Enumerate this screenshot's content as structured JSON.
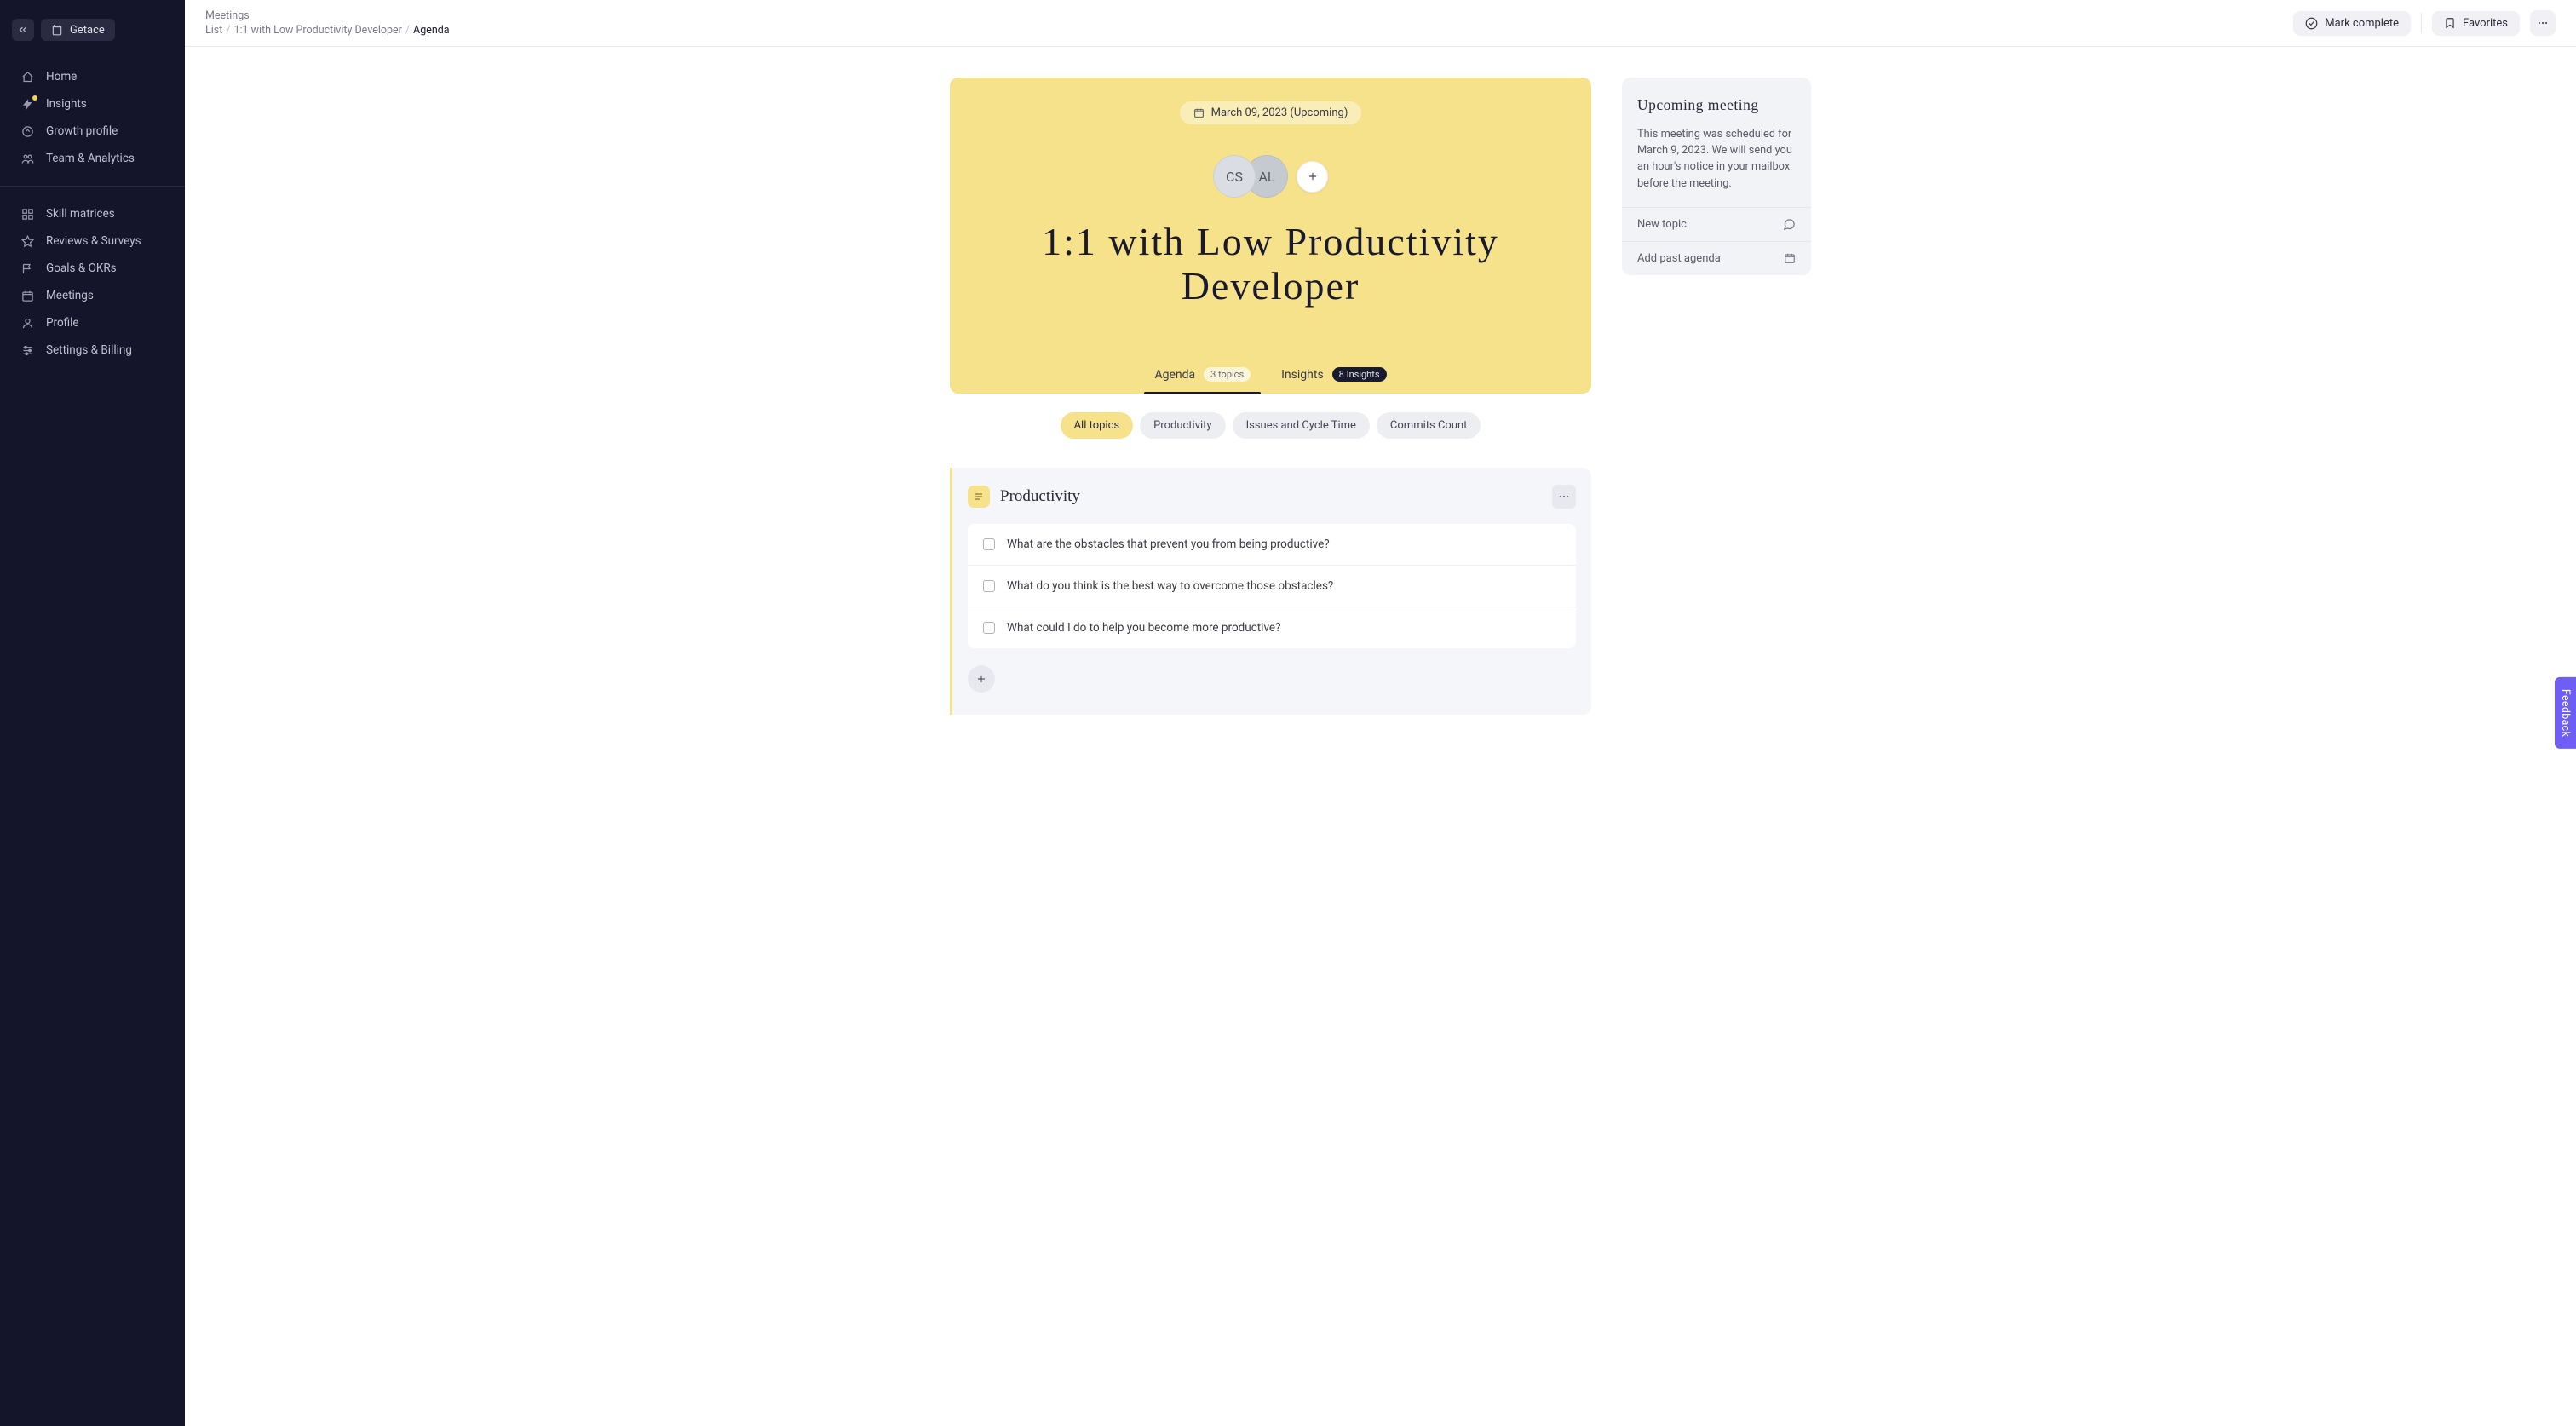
{
  "brand": "Getace",
  "breadcrumb": {
    "top": "Meetings",
    "list": "List",
    "meeting": "1:1 with Low Productivity Developer",
    "current": "Agenda"
  },
  "topbar": {
    "mark_complete": "Mark complete",
    "favorites": "Favorites"
  },
  "sidebar": {
    "section1": [
      {
        "id": "home",
        "label": "Home",
        "icon": "home"
      },
      {
        "id": "insights",
        "label": "Insights",
        "icon": "bolt",
        "badge": true
      },
      {
        "id": "growth",
        "label": "Growth profile",
        "icon": "growth"
      },
      {
        "id": "team",
        "label": "Team & Analytics",
        "icon": "team"
      }
    ],
    "section2": [
      {
        "id": "skill",
        "label": "Skill matrices",
        "icon": "grid"
      },
      {
        "id": "reviews",
        "label": "Reviews & Surveys",
        "icon": "star"
      },
      {
        "id": "goals",
        "label": "Goals & OKRs",
        "icon": "flag"
      },
      {
        "id": "meetings",
        "label": "Meetings",
        "icon": "calendar"
      },
      {
        "id": "profile",
        "label": "Profile",
        "icon": "user"
      },
      {
        "id": "settings",
        "label": "Settings & Billing",
        "icon": "sliders"
      }
    ]
  },
  "hero": {
    "date": "March 09, 2023 (Upcoming)",
    "title": "1:1 with Low Productivity Developer",
    "avatars": [
      "CS",
      "AL"
    ]
  },
  "tabs": {
    "agenda": {
      "label": "Agenda",
      "count": "3 topics"
    },
    "insights": {
      "label": "Insights",
      "count": "8 Insights"
    }
  },
  "filters": [
    {
      "label": "All topics",
      "active": true
    },
    {
      "label": "Productivity",
      "active": false
    },
    {
      "label": "Issues and Cycle Time",
      "active": false
    },
    {
      "label": "Commits Count",
      "active": false
    }
  ],
  "topic": {
    "title": "Productivity",
    "questions": [
      "What are the obstacles that prevent you from being productive?",
      "What do you think is the best way to overcome those obstacles?",
      "What could I do to help you become more productive?"
    ]
  },
  "side": {
    "title": "Upcoming meeting",
    "body": "This meeting was scheduled for March 9, 2023. We will send you an hour's notice in your mailbox before the meeting.",
    "actions": {
      "new_topic": "New topic",
      "add_past": "Add past agenda"
    }
  },
  "feedback": "Feedback"
}
